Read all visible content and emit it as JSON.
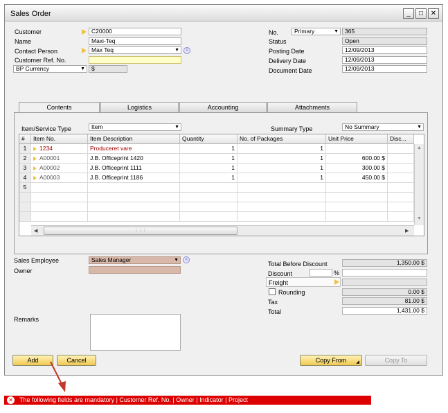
{
  "window": {
    "title": "Sales Order"
  },
  "header_left": {
    "customer": {
      "label": "Customer",
      "value": "C20000"
    },
    "name": {
      "label": "Name",
      "value": "Maxi-Teq"
    },
    "contact_person": {
      "label": "Contact Person",
      "value": "Max Teq"
    },
    "customer_ref": {
      "label": "Customer Ref. No.",
      "value": ""
    },
    "currency": {
      "label": "BP Currency",
      "value": "$"
    }
  },
  "header_right": {
    "no": {
      "label": "No.",
      "series": "Primary",
      "value": "365"
    },
    "status": {
      "label": "Status",
      "value": "Open"
    },
    "posting_date": {
      "label": "Posting Date",
      "value": "12/09/2013"
    },
    "delivery_date": {
      "label": "Delivery Date",
      "value": "12/09/2013"
    },
    "document_date": {
      "label": "Document Date",
      "value": "12/09/2013"
    }
  },
  "tabs": [
    "Contents",
    "Logistics",
    "Accounting",
    "Attachments"
  ],
  "contents": {
    "item_service_type": {
      "label": "Item/Service Type",
      "value": "Item"
    },
    "summary_type": {
      "label": "Summary Type",
      "value": "No Summary"
    },
    "columns": [
      "#",
      "Item No.",
      "Item Description",
      "Quantity",
      "No. of Packages",
      "Unit Price",
      "Disc..."
    ],
    "rows": [
      {
        "num": "1",
        "item_no": "1234",
        "description": "Produceret vare",
        "quantity": "1",
        "packages": "1",
        "unit_price": ""
      },
      {
        "num": "2",
        "item_no": "A00001",
        "description": "J.B. Officeprint 1420",
        "quantity": "1",
        "packages": "1",
        "unit_price": "600.00 $"
      },
      {
        "num": "3",
        "item_no": "A00002",
        "description": "J.B. Officeprint 1111",
        "quantity": "1",
        "packages": "1",
        "unit_price": "300.00 $"
      },
      {
        "num": "4",
        "item_no": "A00003",
        "description": "J.B. Officeprint 1186",
        "quantity": "1",
        "packages": "1",
        "unit_price": "450.00 $"
      },
      {
        "num": "5",
        "item_no": "",
        "description": "",
        "quantity": "",
        "packages": "",
        "unit_price": ""
      }
    ],
    "hscroll_grip": "⋮⋮⋮"
  },
  "footer_left": {
    "sales_employee": {
      "label": "Sales Employee",
      "value": "Sales Manager"
    },
    "owner": {
      "label": "Owner",
      "value": ""
    },
    "remarks": {
      "label": "Remarks",
      "value": ""
    }
  },
  "totals": {
    "total_before_discount": {
      "label": "Total Before Discount",
      "value": "1,350.00 $"
    },
    "discount": {
      "label": "Discount",
      "percent": "",
      "percent_sign": "%",
      "value": ""
    },
    "freight": {
      "label": "Freight",
      "value": ""
    },
    "rounding": {
      "label": "Rounding",
      "value": "0.00 $"
    },
    "tax": {
      "label": "Tax",
      "value": "81.00 $"
    },
    "total": {
      "label": "Total",
      "value": "1,431.00 $"
    }
  },
  "buttons": {
    "add": "Add",
    "cancel": "Cancel",
    "copy_from": "Copy From",
    "copy_to": "Copy To"
  },
  "error_message": "The following fields are mandatory | Customer Ref. No. | Owner | Indicator | Project",
  "colors": {
    "error": "#dd0000",
    "button": "#f0c850",
    "annotation_arrow": "#c0392b"
  }
}
